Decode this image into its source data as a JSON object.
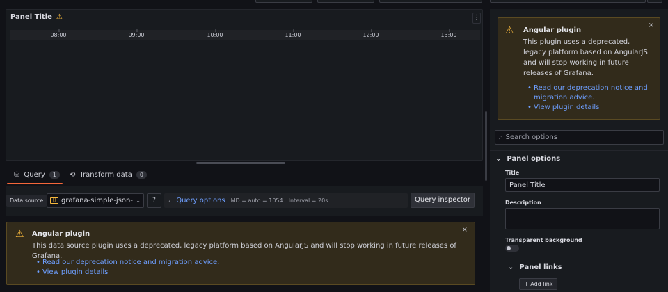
{
  "panel": {
    "title": "Panel Title",
    "menu_icon": "⋮",
    "time_ticks": [
      "08:00",
      "09:00",
      "10:00",
      "11:00",
      "12:00",
      "13:00"
    ]
  },
  "tabs": [
    {
      "label": "Query",
      "count": "1"
    },
    {
      "label": "Transform data",
      "count": "0"
    }
  ],
  "query_row": {
    "ds_label": "Data source",
    "ds_value": "grafana-simple-json-dat",
    "query_options": "Query options",
    "md": "MD = auto = 1054",
    "interval": "Interval = 20s",
    "inspector": "Query inspector"
  },
  "alert_bottom": {
    "title": "Angular plugin",
    "body": "This data source plugin uses a deprecated, legacy platform based on AngularJS and will stop working in future releases of Grafana.",
    "links": [
      "Read our deprecation notice and migration advice.",
      "View plugin details"
    ],
    "close": "×"
  },
  "alert_right": {
    "title": "Angular plugin",
    "body": "This plugin uses a deprecated, legacy platform based on AngularJS and will stop working in future releases of Grafana.",
    "links": [
      "Read our deprecation notice and migration advice.",
      "View plugin details"
    ],
    "close": "×"
  },
  "options": {
    "search_placeholder": "Search options",
    "section": "Panel options",
    "title_label": "Title",
    "title_value": "Panel Title",
    "description_label": "Description",
    "transparent_label": "Transparent background",
    "links_section": "Panel links",
    "add_link": "+ Add link"
  },
  "colors": {
    "accent": "#f5673a",
    "link": "#6e9fff",
    "warning": "#f5b73d"
  }
}
